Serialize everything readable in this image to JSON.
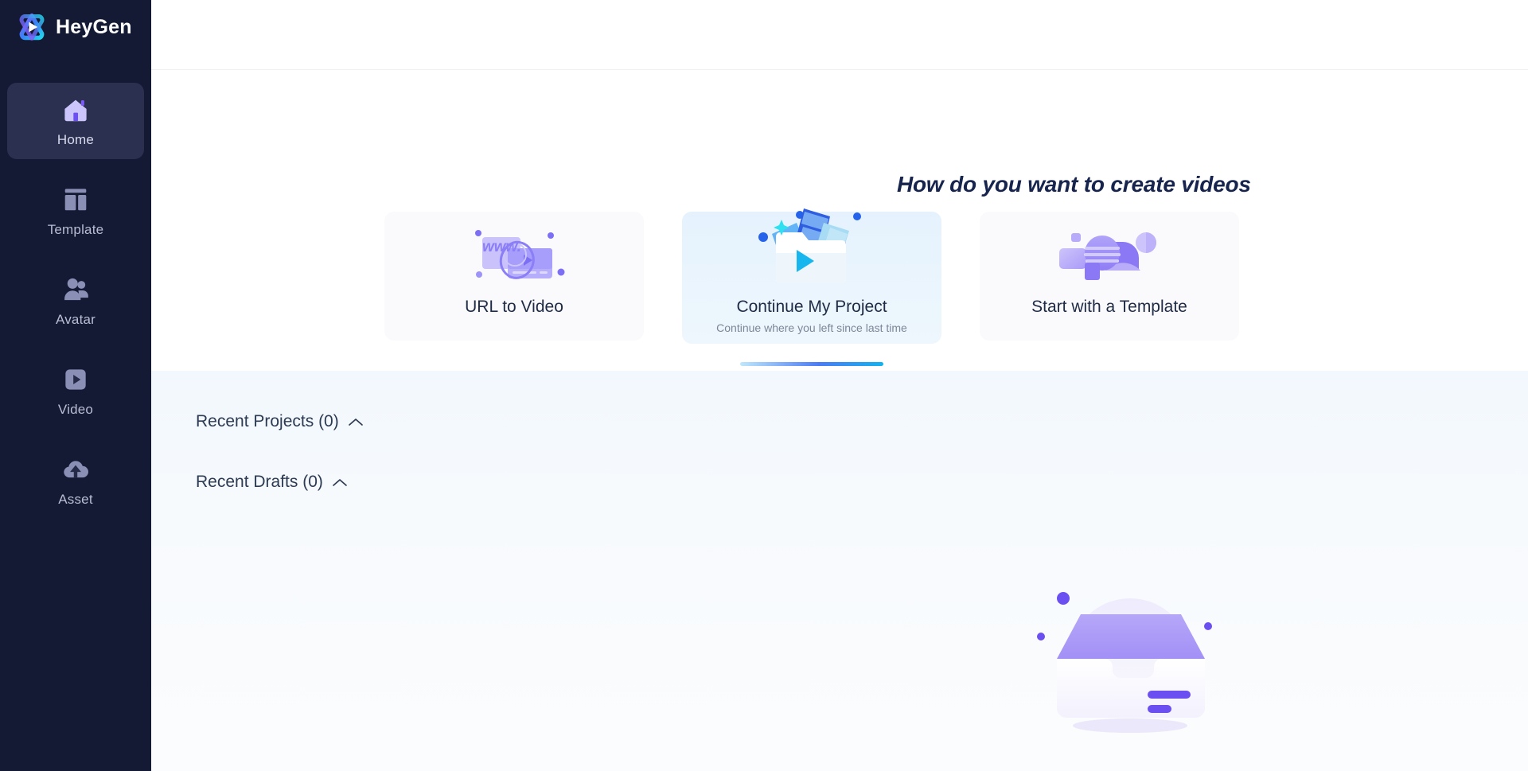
{
  "brand": {
    "name": "HeyGen",
    "logo_icon": "heygen-play-logo-icon"
  },
  "sidebar": {
    "items": [
      {
        "label": "Home",
        "icon": "home-icon",
        "active": true
      },
      {
        "label": "Template",
        "icon": "template-icon",
        "active": false
      },
      {
        "label": "Avatar",
        "icon": "avatar-people-icon",
        "active": false
      },
      {
        "label": "Video",
        "icon": "video-play-icon",
        "active": false
      },
      {
        "label": "Asset",
        "icon": "cloud-upload-icon",
        "active": false
      }
    ],
    "background_color": "#141a33",
    "active_item_color": "#2b3050"
  },
  "hero": {
    "title": "How do you want to create videos",
    "cards": [
      {
        "label": "URL to Video",
        "sub": "",
        "icon": "url-to-video-illustration",
        "active": false
      },
      {
        "label": "Continue My Project",
        "sub": "Continue where you left since last time",
        "icon": "folder-project-illustration",
        "active": true
      },
      {
        "label": "Start with a Template",
        "sub": "",
        "icon": "template-shapes-illustration",
        "active": false
      }
    ],
    "active_underline_color": "#4a7cf6"
  },
  "recent": {
    "projects": {
      "title": "Recent Projects (0)",
      "chevron": "chevron-up-icon",
      "count": 0
    },
    "drafts": {
      "title": "Recent Drafts (0)",
      "chevron": "chevron-up-icon",
      "count": 0
    },
    "empty_illustration": "empty-tray-illustration"
  },
  "colors": {
    "accent_purple": "#6c4ff0",
    "accent_blue": "#2563eb",
    "accent_cyan": "#11b3ef",
    "text_dark": "#17244d"
  }
}
